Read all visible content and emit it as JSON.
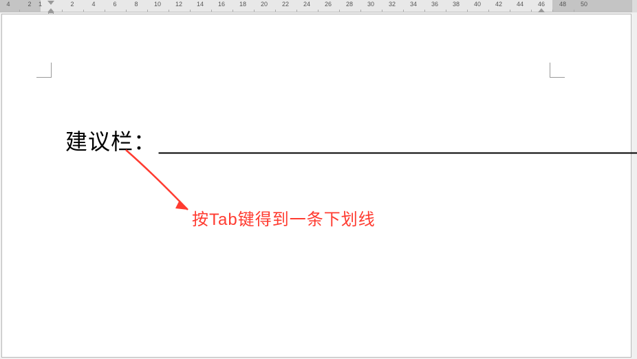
{
  "ruler": {
    "unit": "char",
    "start": -4,
    "end": 50,
    "step": 2,
    "ticks": [
      -4,
      -2,
      -1,
      2,
      4,
      6,
      8,
      10,
      12,
      14,
      16,
      18,
      20,
      22,
      24,
      26,
      28,
      30,
      32,
      34,
      36,
      38,
      40,
      42,
      44,
      46,
      48,
      50
    ],
    "left_margin_end": -1,
    "right_margin_start": 47,
    "indent_left": 0,
    "indent_right": 46
  },
  "document": {
    "label": "建议栏：",
    "underline": "__________________________________________"
  },
  "annotation": {
    "text": "按Tab键得到一条下划线",
    "color": "#ff3b30"
  }
}
